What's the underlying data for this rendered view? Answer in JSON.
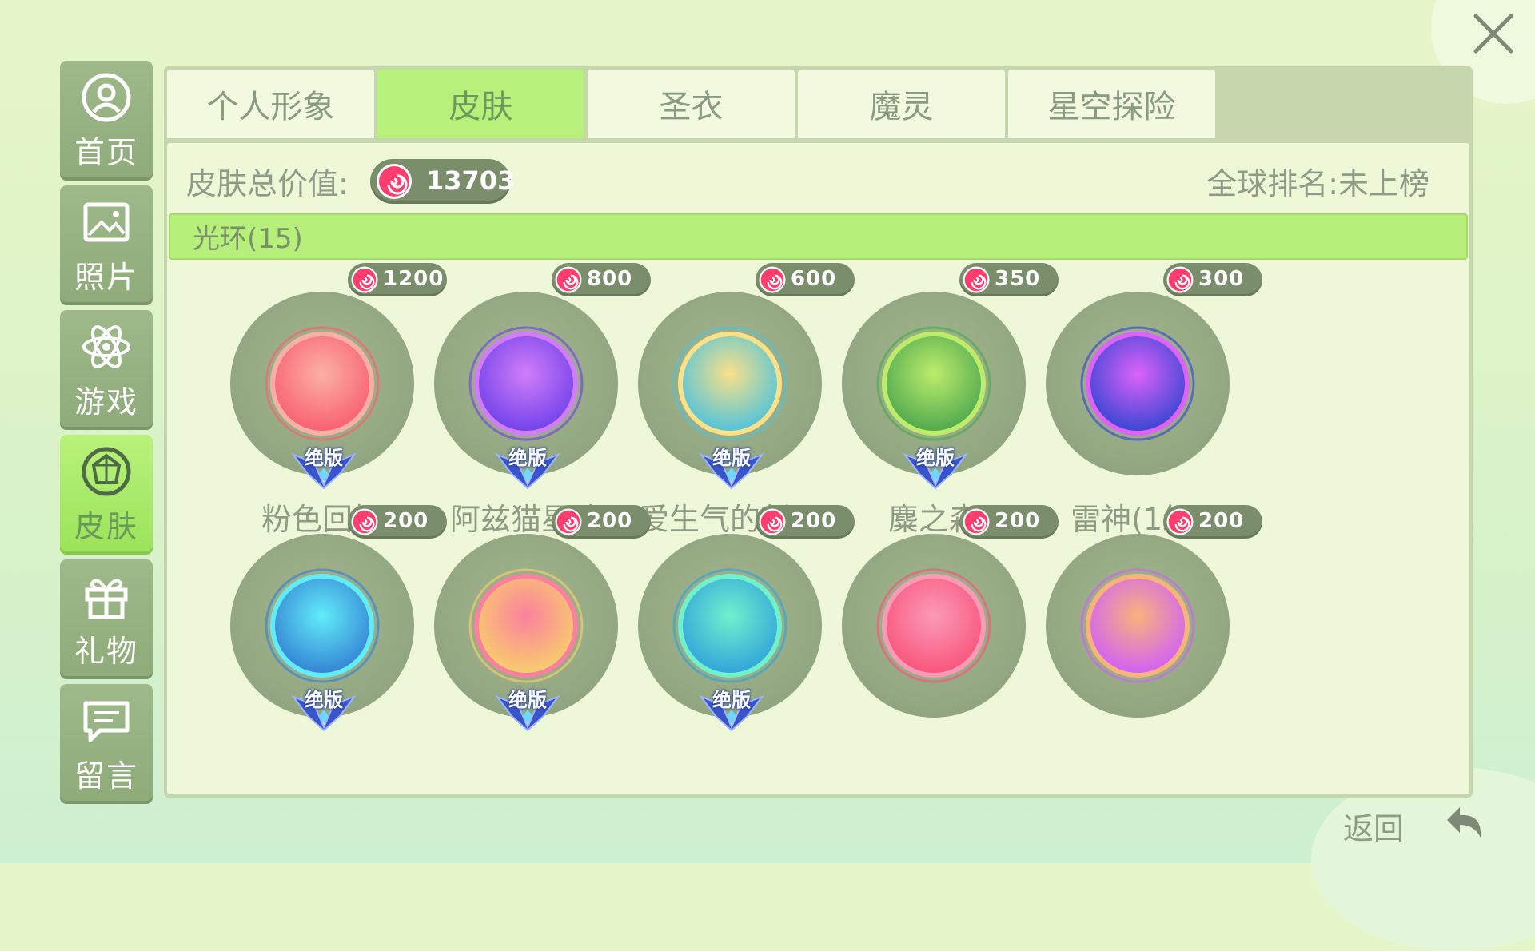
{
  "sidebar": {
    "items": [
      {
        "label": "首页",
        "icon": "profile-icon",
        "active": false
      },
      {
        "label": "照片",
        "icon": "photo-icon",
        "active": false
      },
      {
        "label": "游戏",
        "icon": "atom-icon",
        "active": false
      },
      {
        "label": "皮肤",
        "icon": "gem-icon",
        "active": true
      },
      {
        "label": "礼物",
        "icon": "gift-icon",
        "active": false
      },
      {
        "label": "留言",
        "icon": "message-icon",
        "active": false
      }
    ]
  },
  "tabs": [
    {
      "label": "个人形象",
      "active": false
    },
    {
      "label": "皮肤",
      "active": true
    },
    {
      "label": "圣衣",
      "active": false
    },
    {
      "label": "魔灵",
      "active": false
    },
    {
      "label": "星空探险",
      "active": false
    }
  ],
  "info": {
    "total_label": "皮肤总价值:",
    "total_value": "13703",
    "rank_text": "全球排名:未上榜"
  },
  "section": {
    "title": "光环(15)"
  },
  "items": [
    {
      "name": "粉色回忆",
      "price": "1200",
      "badge": "绝版",
      "colors": [
        "#ffb1a6",
        "#ff5b6e"
      ]
    },
    {
      "name": "阿兹猫星阵",
      "price": "800",
      "badge": "绝版",
      "colors": [
        "#d47bff",
        "#6e3cf0"
      ]
    },
    {
      "name": "爱生气的刺儿",
      "price": "600",
      "badge": "绝版",
      "colors": [
        "#ffe48a",
        "#4bc4e0"
      ]
    },
    {
      "name": "麋之森",
      "price": "350",
      "badge": "绝版",
      "colors": [
        "#bff06a",
        "#4aa84c"
      ]
    },
    {
      "name": "雷神(1级)",
      "price": "300",
      "badge": "",
      "colors": [
        "#e05fff",
        "#3140d8"
      ]
    },
    {
      "name": "",
      "price": "200",
      "badge": "绝版",
      "colors": [
        "#5ef0ff",
        "#2f7fd8"
      ]
    },
    {
      "name": "",
      "price": "200",
      "badge": "绝版",
      "colors": [
        "#ff7ea0",
        "#ffd26a"
      ]
    },
    {
      "name": "",
      "price": "200",
      "badge": "绝版",
      "colors": [
        "#6ef5d0",
        "#2aa3e0"
      ]
    },
    {
      "name": "",
      "price": "200",
      "badge": "",
      "colors": [
        "#ff9ab8",
        "#ff4f7a"
      ]
    },
    {
      "name": "",
      "price": "200",
      "badge": "",
      "colors": [
        "#ffb37a",
        "#d35cff"
      ]
    }
  ],
  "footer": {
    "back_label": "返回"
  },
  "theme": {
    "accent": "#b7f07a",
    "panel": "#c6d7ae",
    "pill": "#7a8e6c"
  }
}
